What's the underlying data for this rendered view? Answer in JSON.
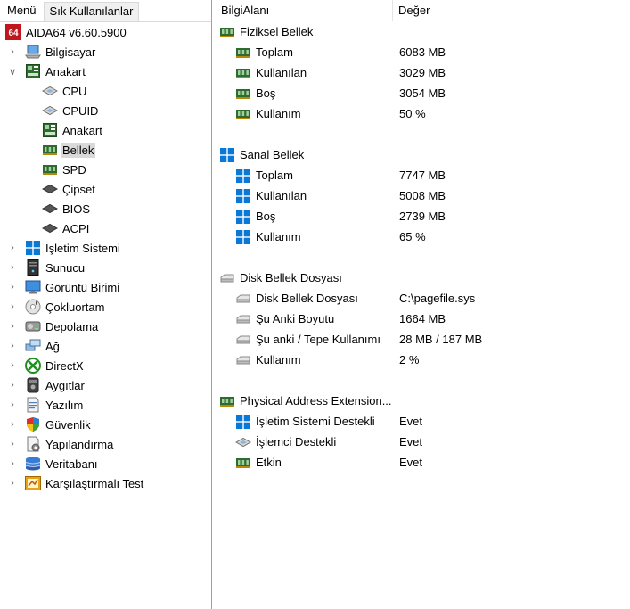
{
  "left_panel": {
    "tabs": [
      "Menü",
      "Sık Kullanılanlar"
    ],
    "app_title": "AIDA64 v6.60.5900",
    "app_logo_text": "64",
    "tree": [
      {
        "label": "Bilgisayar",
        "icon": "computer-icon",
        "expander": "collapsed",
        "level": 1
      },
      {
        "label": "Anakart",
        "icon": "motherboard-icon",
        "expander": "expanded",
        "level": 1
      },
      {
        "label": "CPU",
        "icon": "cpu-chip-icon",
        "level": 2
      },
      {
        "label": "CPUID",
        "icon": "cpu-chip-icon",
        "level": 2
      },
      {
        "label": "Anakart",
        "icon": "motherboard-icon",
        "level": 2
      },
      {
        "label": "Bellek",
        "icon": "memory-icon",
        "level": 2,
        "selected": true
      },
      {
        "label": "SPD",
        "icon": "memory-icon",
        "level": 2
      },
      {
        "label": "Çipset",
        "icon": "chipset-icon",
        "level": 2
      },
      {
        "label": "BIOS",
        "icon": "chipset-icon",
        "level": 2
      },
      {
        "label": "ACPI",
        "icon": "chipset-icon",
        "level": 2
      },
      {
        "label": "İşletim Sistemi",
        "icon": "windows-icon",
        "expander": "collapsed",
        "level": 1
      },
      {
        "label": "Sunucu",
        "icon": "server-icon",
        "expander": "collapsed",
        "level": 1
      },
      {
        "label": "Görüntü Birimi",
        "icon": "monitor-icon",
        "expander": "collapsed",
        "level": 1
      },
      {
        "label": "Çokluortam",
        "icon": "multimedia-icon",
        "expander": "collapsed",
        "level": 1
      },
      {
        "label": "Depolama",
        "icon": "storage-icon",
        "expander": "collapsed",
        "level": 1
      },
      {
        "label": "Ağ",
        "icon": "network-icon",
        "expander": "collapsed",
        "level": 1
      },
      {
        "label": "DirectX",
        "icon": "xbox-icon",
        "expander": "collapsed",
        "level": 1
      },
      {
        "label": "Aygıtlar",
        "icon": "devices-icon",
        "expander": "collapsed",
        "level": 1
      },
      {
        "label": "Yazılım",
        "icon": "software-icon",
        "expander": "collapsed",
        "level": 1
      },
      {
        "label": "Güvenlik",
        "icon": "shield-icon",
        "expander": "collapsed",
        "level": 1
      },
      {
        "label": "Yapılandırma",
        "icon": "config-icon",
        "expander": "collapsed",
        "level": 1
      },
      {
        "label": "Veritabanı",
        "icon": "database-icon",
        "expander": "collapsed",
        "level": 1
      },
      {
        "label": "Karşılaştırmalı Test",
        "icon": "benchmark-icon",
        "expander": "collapsed",
        "level": 1
      }
    ]
  },
  "right_panel": {
    "columns": [
      "BilgiAlanı",
      "Değer"
    ],
    "groups": [
      {
        "title": "Fiziksel Bellek",
        "icon": "memory-icon",
        "items": [
          {
            "label": "Toplam",
            "value": "6083 MB",
            "icon": "memory-icon"
          },
          {
            "label": "Kullanılan",
            "value": "3029 MB",
            "icon": "memory-icon"
          },
          {
            "label": "Boş",
            "value": "3054 MB",
            "icon": "memory-icon"
          },
          {
            "label": "Kullanım",
            "value": "50 %",
            "icon": "memory-icon"
          }
        ]
      },
      {
        "title": "Sanal Bellek",
        "icon": "windows-icon",
        "items": [
          {
            "label": "Toplam",
            "value": "7747 MB",
            "icon": "windows-icon"
          },
          {
            "label": "Kullanılan",
            "value": "5008 MB",
            "icon": "windows-icon"
          },
          {
            "label": "Boş",
            "value": "2739 MB",
            "icon": "windows-icon"
          },
          {
            "label": "Kullanım",
            "value": "65 %",
            "icon": "windows-icon"
          }
        ]
      },
      {
        "title": "Disk Bellek Dosyası",
        "icon": "drive-icon",
        "items": [
          {
            "label": "Disk Bellek Dosyası",
            "value": "C:\\pagefile.sys",
            "icon": "drive-icon"
          },
          {
            "label": "Şu Anki Boyutu",
            "value": "1664 MB",
            "icon": "drive-icon"
          },
          {
            "label": "Şu anki / Tepe Kullanımı",
            "value": "28 MB / 187 MB",
            "icon": "drive-icon"
          },
          {
            "label": "Kullanım",
            "value": "2 %",
            "icon": "drive-icon"
          }
        ]
      },
      {
        "title": "Physical Address Extension...",
        "icon": "memory-icon",
        "items": [
          {
            "label": "İşletim Sistemi Destekli",
            "value": "Evet",
            "icon": "windows-icon"
          },
          {
            "label": "İşlemci Destekli",
            "value": "Evet",
            "icon": "cpu-chip-icon"
          },
          {
            "label": "Etkin",
            "value": "Evet",
            "icon": "memory-icon"
          }
        ]
      }
    ]
  },
  "colors": {
    "windows_blue": "#0a78d7",
    "memory_green": "#2f6b2f",
    "selection_gray": "#d9d9d9",
    "app_logo_red": "#c0161d"
  }
}
